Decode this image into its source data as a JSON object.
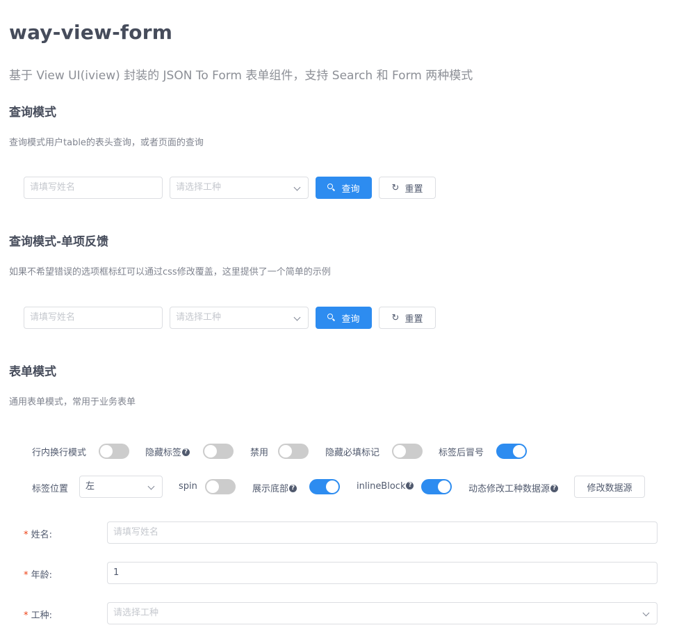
{
  "header": {
    "title": "way-view-form",
    "subtitle": "基于 View UI(iview) 封装的 JSON To Form 表单组件，支持 Search 和 Form 两种模式"
  },
  "section1": {
    "heading": "查询模式",
    "desc": "查询模式用户table的表头查询，或者页面的查询",
    "name_placeholder": "请填写姓名",
    "job_placeholder": "请选择工种",
    "search_label": "查询",
    "reset_label": "重置"
  },
  "section2": {
    "heading": "查询模式-单项反馈",
    "desc": "如果不希望错误的选项框标红可以通过css修改覆盖，这里提供了一个简单的示例",
    "name_placeholder": "请填写姓名",
    "job_placeholder": "请选择工种",
    "search_label": "查询",
    "reset_label": "重置"
  },
  "section3": {
    "heading": "表单模式",
    "desc": "通用表单模式，常用于业务表单"
  },
  "options": {
    "row1": [
      {
        "label": "行内换行模式",
        "help": false,
        "on": false
      },
      {
        "label": "隐藏标签",
        "help": true,
        "on": false
      },
      {
        "label": "禁用",
        "help": false,
        "on": false
      },
      {
        "label": "隐藏必填标记",
        "help": false,
        "on": false
      },
      {
        "label": "标签后冒号",
        "help": false,
        "on": true
      }
    ],
    "label_position_label": "标签位置",
    "label_position_value": "左",
    "spin_label": "spin",
    "spin_on": false,
    "show_footer_label": "展示底部",
    "show_footer_on": true,
    "inline_block_label": "inlineBlock",
    "inline_block_on": true,
    "dynamic_label": "动态修改工种数据源",
    "modify_button_label": "修改数据源",
    "help_glyph": "?"
  },
  "form": {
    "required_mark": "*",
    "name_label": "姓名:",
    "name_placeholder": "请填写姓名",
    "age_label": "年龄:",
    "age_value": "1",
    "job_label": "工种:",
    "job_placeholder": "请选择工种"
  },
  "colors": {
    "primary": "#2d8cf0",
    "switch_off": "#cccccc",
    "required": "#ed4014"
  },
  "icons": {
    "search": "search-icon",
    "reset": "refresh-icon",
    "dropdown": "chevron-down-icon",
    "help": "help-icon"
  }
}
